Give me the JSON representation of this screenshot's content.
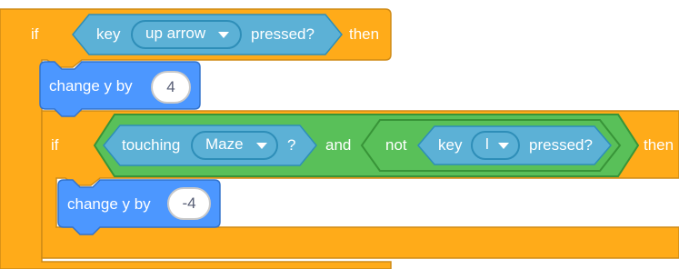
{
  "outer_if": {
    "if_label": "if",
    "then_label": "then",
    "condition": {
      "key_label": "key",
      "key_value": "up arrow",
      "pressed_label": "pressed?"
    }
  },
  "change_y_1": {
    "label": "change y by",
    "value": "4"
  },
  "inner_if": {
    "if_label": "if",
    "then_label": "then",
    "condition": {
      "touching_label": "touching",
      "touching_value": "Maze",
      "question_mark": "?",
      "and_label": "and",
      "not_label": "not",
      "key_label": "key",
      "key_value": "l",
      "pressed_label": "pressed?"
    }
  },
  "change_y_2": {
    "label": "change y by",
    "value": "-4"
  },
  "colors": {
    "control": "#ffab19",
    "control_edge": "#cf8b17",
    "motion": "#4c97ff",
    "motion_edge": "#3373cc",
    "sensing": "#5cb1d6",
    "sensing_edge": "#2e8eb8",
    "operators": "#59c059",
    "operators_edge": "#389438"
  }
}
